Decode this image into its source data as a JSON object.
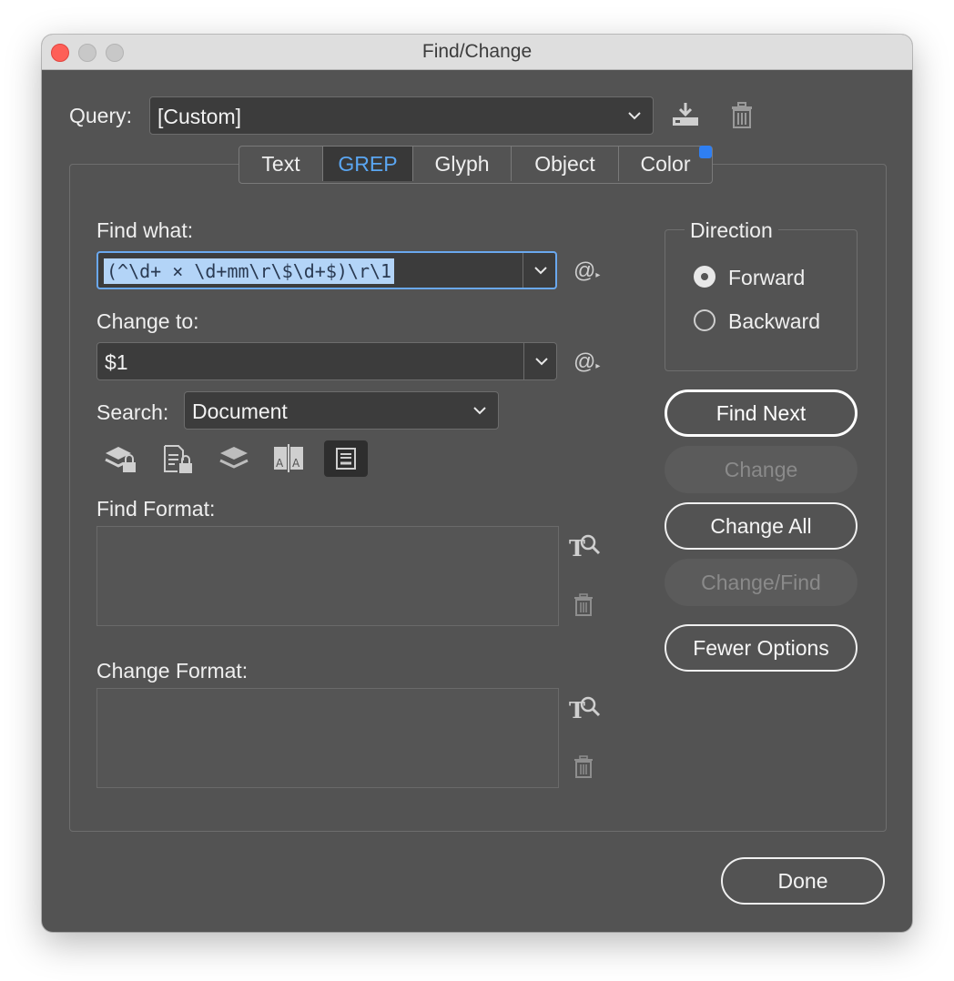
{
  "window": {
    "title": "Find/Change"
  },
  "query": {
    "label": "Query:",
    "value": "[Custom]"
  },
  "tabs": [
    {
      "label": "Text",
      "active": false
    },
    {
      "label": "GREP",
      "active": true
    },
    {
      "label": "Glyph",
      "active": false
    },
    {
      "label": "Object",
      "active": false
    },
    {
      "label": "Color",
      "active": false
    }
  ],
  "find_what": {
    "label": "Find what:",
    "value": "(^\\d+ × \\d+mm\\r\\$\\d+$)\\r\\1"
  },
  "change_to": {
    "label": "Change to:",
    "value": "$1"
  },
  "search": {
    "label": "Search:",
    "value": "Document"
  },
  "option_icons": [
    "locked-layers-icon",
    "locked-stories-icon",
    "hidden-layers-icon",
    "master-pages-icon",
    "footnotes-icon"
  ],
  "find_format": {
    "label": "Find Format:"
  },
  "change_format": {
    "label": "Change Format:"
  },
  "direction": {
    "label": "Direction",
    "options": [
      "Forward",
      "Backward"
    ],
    "selected": "Forward"
  },
  "buttons": {
    "find_next": "Find Next",
    "change": "Change",
    "change_all": "Change All",
    "change_find": "Change/Find",
    "fewer_options": "Fewer Options",
    "done": "Done"
  },
  "colors": {
    "accent": "#5aa6f2",
    "selection": "#b3d4f7",
    "background": "#535353"
  }
}
